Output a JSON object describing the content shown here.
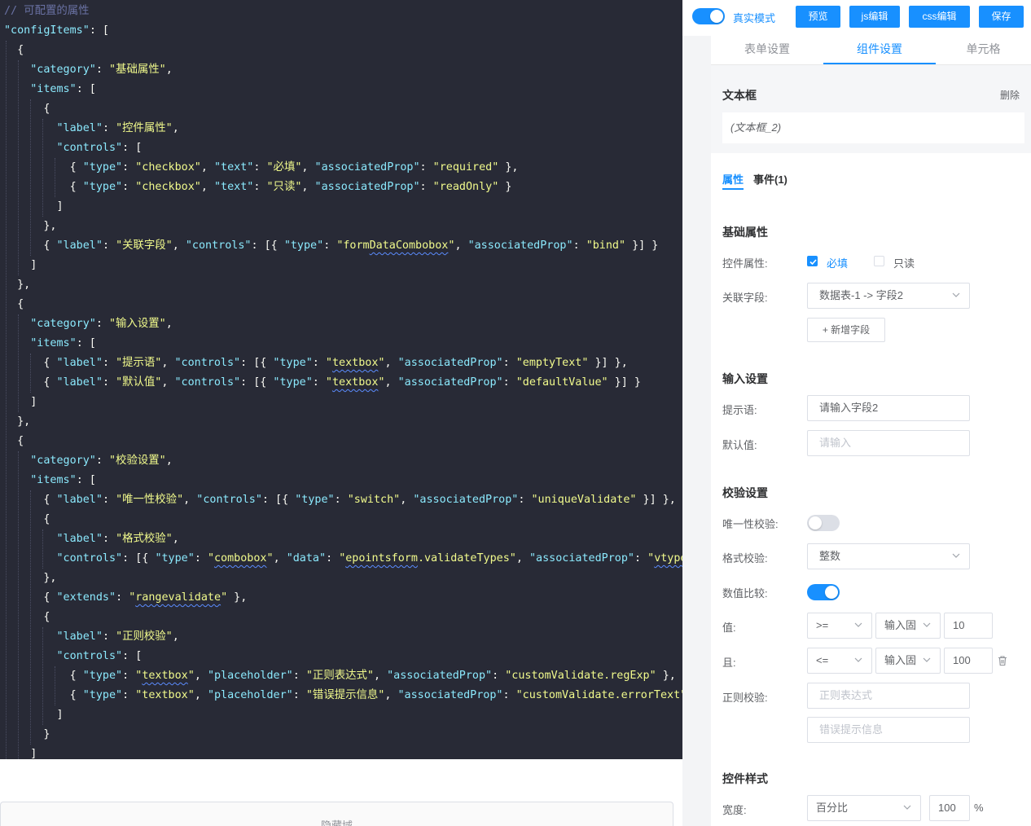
{
  "editor": {
    "lines": [
      {
        "indent": 0,
        "tokens": [
          [
            "com",
            "// 可配置的属性"
          ]
        ]
      },
      {
        "indent": 0,
        "tokens": [
          [
            "key",
            "\"configItems\""
          ],
          [
            "pun",
            ": ["
          ]
        ]
      },
      {
        "indent": 1,
        "tokens": [
          [
            "pun",
            "{"
          ]
        ]
      },
      {
        "indent": 2,
        "tokens": [
          [
            "key",
            "\"category\""
          ],
          [
            "pun",
            ": "
          ],
          [
            "str",
            "\"基础属性\""
          ],
          [
            "pun",
            ","
          ]
        ]
      },
      {
        "indent": 2,
        "tokens": [
          [
            "key",
            "\"items\""
          ],
          [
            "pun",
            ": ["
          ]
        ]
      },
      {
        "indent": 3,
        "tokens": [
          [
            "pun",
            "{"
          ]
        ]
      },
      {
        "indent": 4,
        "tokens": [
          [
            "key",
            "\"label\""
          ],
          [
            "pun",
            ": "
          ],
          [
            "str",
            "\"控件属性\""
          ],
          [
            "pun",
            ","
          ]
        ]
      },
      {
        "indent": 4,
        "tokens": [
          [
            "key",
            "\"controls\""
          ],
          [
            "pun",
            ": ["
          ]
        ]
      },
      {
        "indent": 5,
        "tokens": [
          [
            "pun",
            "{ "
          ],
          [
            "key",
            "\"type\""
          ],
          [
            "pun",
            ": "
          ],
          [
            "str",
            "\"checkbox\""
          ],
          [
            "pun",
            ", "
          ],
          [
            "key",
            "\"text\""
          ],
          [
            "pun",
            ": "
          ],
          [
            "str",
            "\"必填\""
          ],
          [
            "pun",
            ", "
          ],
          [
            "key",
            "\"associatedProp\""
          ],
          [
            "pun",
            ": "
          ],
          [
            "str",
            "\"required\""
          ],
          [
            "pun",
            " },"
          ]
        ]
      },
      {
        "indent": 5,
        "tokens": [
          [
            "pun",
            "{ "
          ],
          [
            "key",
            "\"type\""
          ],
          [
            "pun",
            ": "
          ],
          [
            "str",
            "\"checkbox\""
          ],
          [
            "pun",
            ", "
          ],
          [
            "key",
            "\"text\""
          ],
          [
            "pun",
            ": "
          ],
          [
            "str",
            "\"只读\""
          ],
          [
            "pun",
            ", "
          ],
          [
            "key",
            "\"associatedProp\""
          ],
          [
            "pun",
            ": "
          ],
          [
            "str",
            "\"readOnly\""
          ],
          [
            "pun",
            " }"
          ]
        ]
      },
      {
        "indent": 4,
        "tokens": [
          [
            "pun",
            "]"
          ]
        ]
      },
      {
        "indent": 3,
        "tokens": [
          [
            "pun",
            "},"
          ]
        ]
      },
      {
        "indent": 3,
        "tokens": [
          [
            "pun",
            "{ "
          ],
          [
            "key",
            "\"label\""
          ],
          [
            "pun",
            ": "
          ],
          [
            "str",
            "\"关联字段\""
          ],
          [
            "pun",
            ", "
          ],
          [
            "key",
            "\"controls\""
          ],
          [
            "pun",
            ": [{ "
          ],
          [
            "key",
            "\"type\""
          ],
          [
            "pun",
            ": "
          ],
          [
            "str",
            "\"form"
          ],
          [
            "sq",
            "DataCombobox"
          ],
          [
            "str",
            "\""
          ],
          [
            "pun",
            ", "
          ],
          [
            "key",
            "\"associatedProp\""
          ],
          [
            "pun",
            ": "
          ],
          [
            "str",
            "\"bind\""
          ],
          [
            "pun",
            " }] }"
          ]
        ]
      },
      {
        "indent": 2,
        "tokens": [
          [
            "pun",
            "]"
          ]
        ]
      },
      {
        "indent": 1,
        "tokens": [
          [
            "pun",
            "},"
          ]
        ]
      },
      {
        "indent": 1,
        "tokens": [
          [
            "pun",
            "{"
          ]
        ]
      },
      {
        "indent": 2,
        "tokens": [
          [
            "key",
            "\"category\""
          ],
          [
            "pun",
            ": "
          ],
          [
            "str",
            "\"输入设置\""
          ],
          [
            "pun",
            ","
          ]
        ]
      },
      {
        "indent": 2,
        "tokens": [
          [
            "key",
            "\"items\""
          ],
          [
            "pun",
            ": ["
          ]
        ]
      },
      {
        "indent": 3,
        "tokens": [
          [
            "pun",
            "{ "
          ],
          [
            "key",
            "\"label\""
          ],
          [
            "pun",
            ": "
          ],
          [
            "str",
            "\"提示语\""
          ],
          [
            "pun",
            ", "
          ],
          [
            "key",
            "\"controls\""
          ],
          [
            "pun",
            ": [{ "
          ],
          [
            "key",
            "\"type\""
          ],
          [
            "pun",
            ": "
          ],
          [
            "str",
            "\""
          ],
          [
            "sq",
            "textbox"
          ],
          [
            "str",
            "\""
          ],
          [
            "pun",
            ", "
          ],
          [
            "key",
            "\"associatedProp\""
          ],
          [
            "pun",
            ": "
          ],
          [
            "str",
            "\"emptyText\""
          ],
          [
            "pun",
            " }] },"
          ]
        ]
      },
      {
        "indent": 3,
        "tokens": [
          [
            "pun",
            "{ "
          ],
          [
            "key",
            "\"label\""
          ],
          [
            "pun",
            ": "
          ],
          [
            "str",
            "\"默认值\""
          ],
          [
            "pun",
            ", "
          ],
          [
            "key",
            "\"controls\""
          ],
          [
            "pun",
            ": [{ "
          ],
          [
            "key",
            "\"type\""
          ],
          [
            "pun",
            ": "
          ],
          [
            "str",
            "\""
          ],
          [
            "sq",
            "textbox"
          ],
          [
            "str",
            "\""
          ],
          [
            "pun",
            ", "
          ],
          [
            "key",
            "\"associatedProp\""
          ],
          [
            "pun",
            ": "
          ],
          [
            "str",
            "\"defaultValue\""
          ],
          [
            "pun",
            " }] }"
          ]
        ]
      },
      {
        "indent": 2,
        "tokens": [
          [
            "pun",
            "]"
          ]
        ]
      },
      {
        "indent": 1,
        "tokens": [
          [
            "pun",
            "},"
          ]
        ]
      },
      {
        "indent": 1,
        "tokens": [
          [
            "pun",
            "{"
          ]
        ]
      },
      {
        "indent": 2,
        "tokens": [
          [
            "key",
            "\"category\""
          ],
          [
            "pun",
            ": "
          ],
          [
            "str",
            "\"校验设置\""
          ],
          [
            "pun",
            ","
          ]
        ]
      },
      {
        "indent": 2,
        "tokens": [
          [
            "key",
            "\"items\""
          ],
          [
            "pun",
            ": ["
          ]
        ]
      },
      {
        "indent": 3,
        "tokens": [
          [
            "pun",
            "{ "
          ],
          [
            "key",
            "\"label\""
          ],
          [
            "pun",
            ": "
          ],
          [
            "str",
            "\"唯一性校验\""
          ],
          [
            "pun",
            ", "
          ],
          [
            "key",
            "\"controls\""
          ],
          [
            "pun",
            ": [{ "
          ],
          [
            "key",
            "\"type\""
          ],
          [
            "pun",
            ": "
          ],
          [
            "str",
            "\"switch\""
          ],
          [
            "pun",
            ", "
          ],
          [
            "key",
            "\"associatedProp\""
          ],
          [
            "pun",
            ": "
          ],
          [
            "str",
            "\"uniqueValidate\""
          ],
          [
            "pun",
            " }] },"
          ]
        ]
      },
      {
        "indent": 3,
        "tokens": [
          [
            "pun",
            "{"
          ]
        ]
      },
      {
        "indent": 4,
        "tokens": [
          [
            "key",
            "\"label\""
          ],
          [
            "pun",
            ": "
          ],
          [
            "str",
            "\"格式校验\""
          ],
          [
            "pun",
            ","
          ]
        ]
      },
      {
        "indent": 4,
        "tokens": [
          [
            "key",
            "\"controls\""
          ],
          [
            "pun",
            ": [{ "
          ],
          [
            "key",
            "\"type\""
          ],
          [
            "pun",
            ": "
          ],
          [
            "str",
            "\""
          ],
          [
            "sq",
            "combobox"
          ],
          [
            "str",
            "\""
          ],
          [
            "pun",
            ", "
          ],
          [
            "key",
            "\"data\""
          ],
          [
            "pun",
            ": "
          ],
          [
            "str",
            "\""
          ],
          [
            "sq",
            "epointsform"
          ],
          [
            "str",
            ".validateTypes\""
          ],
          [
            "pun",
            ", "
          ],
          [
            "key",
            "\"associatedProp\""
          ],
          [
            "pun",
            ": "
          ],
          [
            "str",
            "\""
          ],
          [
            "sq",
            "vtype"
          ],
          [
            "str",
            "\""
          ],
          [
            "pun",
            " }]"
          ]
        ]
      },
      {
        "indent": 3,
        "tokens": [
          [
            "pun",
            "},"
          ]
        ]
      },
      {
        "indent": 3,
        "tokens": [
          [
            "pun",
            "{ "
          ],
          [
            "key",
            "\"extends\""
          ],
          [
            "pun",
            ": "
          ],
          [
            "str",
            "\""
          ],
          [
            "sq",
            "rangevalidate"
          ],
          [
            "str",
            "\""
          ],
          [
            "pun",
            " },"
          ]
        ]
      },
      {
        "indent": 3,
        "tokens": [
          [
            "pun",
            "{"
          ]
        ]
      },
      {
        "indent": 4,
        "tokens": [
          [
            "key",
            "\"label\""
          ],
          [
            "pun",
            ": "
          ],
          [
            "str",
            "\"正则校验\""
          ],
          [
            "pun",
            ","
          ]
        ]
      },
      {
        "indent": 4,
        "tokens": [
          [
            "key",
            "\"controls\""
          ],
          [
            "pun",
            ": ["
          ]
        ]
      },
      {
        "indent": 5,
        "tokens": [
          [
            "pun",
            "{ "
          ],
          [
            "key",
            "\"type\""
          ],
          [
            "pun",
            ": "
          ],
          [
            "str",
            "\""
          ],
          [
            "sq",
            "textbox"
          ],
          [
            "str",
            "\""
          ],
          [
            "pun",
            ", "
          ],
          [
            "key",
            "\"placeholder\""
          ],
          [
            "pun",
            ": "
          ],
          [
            "str",
            "\"正则表达式\""
          ],
          [
            "pun",
            ", "
          ],
          [
            "key",
            "\"associatedProp\""
          ],
          [
            "pun",
            ": "
          ],
          [
            "str",
            "\"customValidate.regExp\""
          ],
          [
            "pun",
            " },"
          ]
        ]
      },
      {
        "indent": 5,
        "tokens": [
          [
            "pun",
            "{ "
          ],
          [
            "key",
            "\"type\""
          ],
          [
            "pun",
            ": "
          ],
          [
            "str",
            "\"textbox\""
          ],
          [
            "pun",
            ", "
          ],
          [
            "key",
            "\"placeholder\""
          ],
          [
            "pun",
            ": "
          ],
          [
            "str",
            "\"错误提示信息\""
          ],
          [
            "pun",
            ", "
          ],
          [
            "key",
            "\"associatedProp\""
          ],
          [
            "pun",
            ": "
          ],
          [
            "str",
            "\"customValidate.errorText\""
          ],
          [
            "pun",
            " }"
          ]
        ]
      },
      {
        "indent": 4,
        "tokens": [
          [
            "pun",
            "]"
          ]
        ]
      },
      {
        "indent": 3,
        "tokens": [
          [
            "pun",
            "}"
          ]
        ]
      },
      {
        "indent": 2,
        "tokens": [
          [
            "pun",
            "]"
          ]
        ]
      }
    ]
  },
  "hidden_field": {
    "label": "隐藏域"
  },
  "toolbar": {
    "real_mode_label": "真实模式",
    "real_mode_on": true,
    "buttons": {
      "preview": "预览",
      "js_edit": "js编辑",
      "css_edit": "css编辑",
      "save": "保存"
    },
    "accent": "#1890ff"
  },
  "tabs": {
    "form_settings": "表单设置",
    "component_settings": "组件设置",
    "cell": "单元格"
  },
  "component": {
    "title": "文本框",
    "delete": "删除",
    "id": "(文本框_2)"
  },
  "subtabs": {
    "props": "属性",
    "events": "事件(1)"
  },
  "basic": {
    "title": "基础属性",
    "control_props_label": "控件属性:",
    "required_label": "必填",
    "required_checked": true,
    "readonly_label": "只读",
    "readonly_checked": false,
    "bind_label": "关联字段:",
    "bind_value": "数据表-1 -> 字段2",
    "add_field": "+ 新增字段"
  },
  "input": {
    "title": "输入设置",
    "hint_label": "提示语:",
    "hint_value": "请输入字段2",
    "default_label": "默认值:",
    "default_placeholder": "请输入"
  },
  "validate": {
    "title": "校验设置",
    "unique_label": "唯一性校验:",
    "unique_on": false,
    "format_label": "格式校验:",
    "format_value": "整数",
    "compare_label": "数值比较:",
    "compare_on": true,
    "value_label": "值:",
    "op1": ">=",
    "mode1": "输入固",
    "val1": "10",
    "and_label": "且:",
    "op2": "<=",
    "mode2": "输入固",
    "val2": "100",
    "regex_label": "正则校验:",
    "regex_placeholder": "正则表达式",
    "error_placeholder": "错误提示信息"
  },
  "style": {
    "title": "控件样式",
    "width_label": "宽度:",
    "width_unit": "百分比",
    "width_value": "100",
    "pct_symbol": "%"
  }
}
